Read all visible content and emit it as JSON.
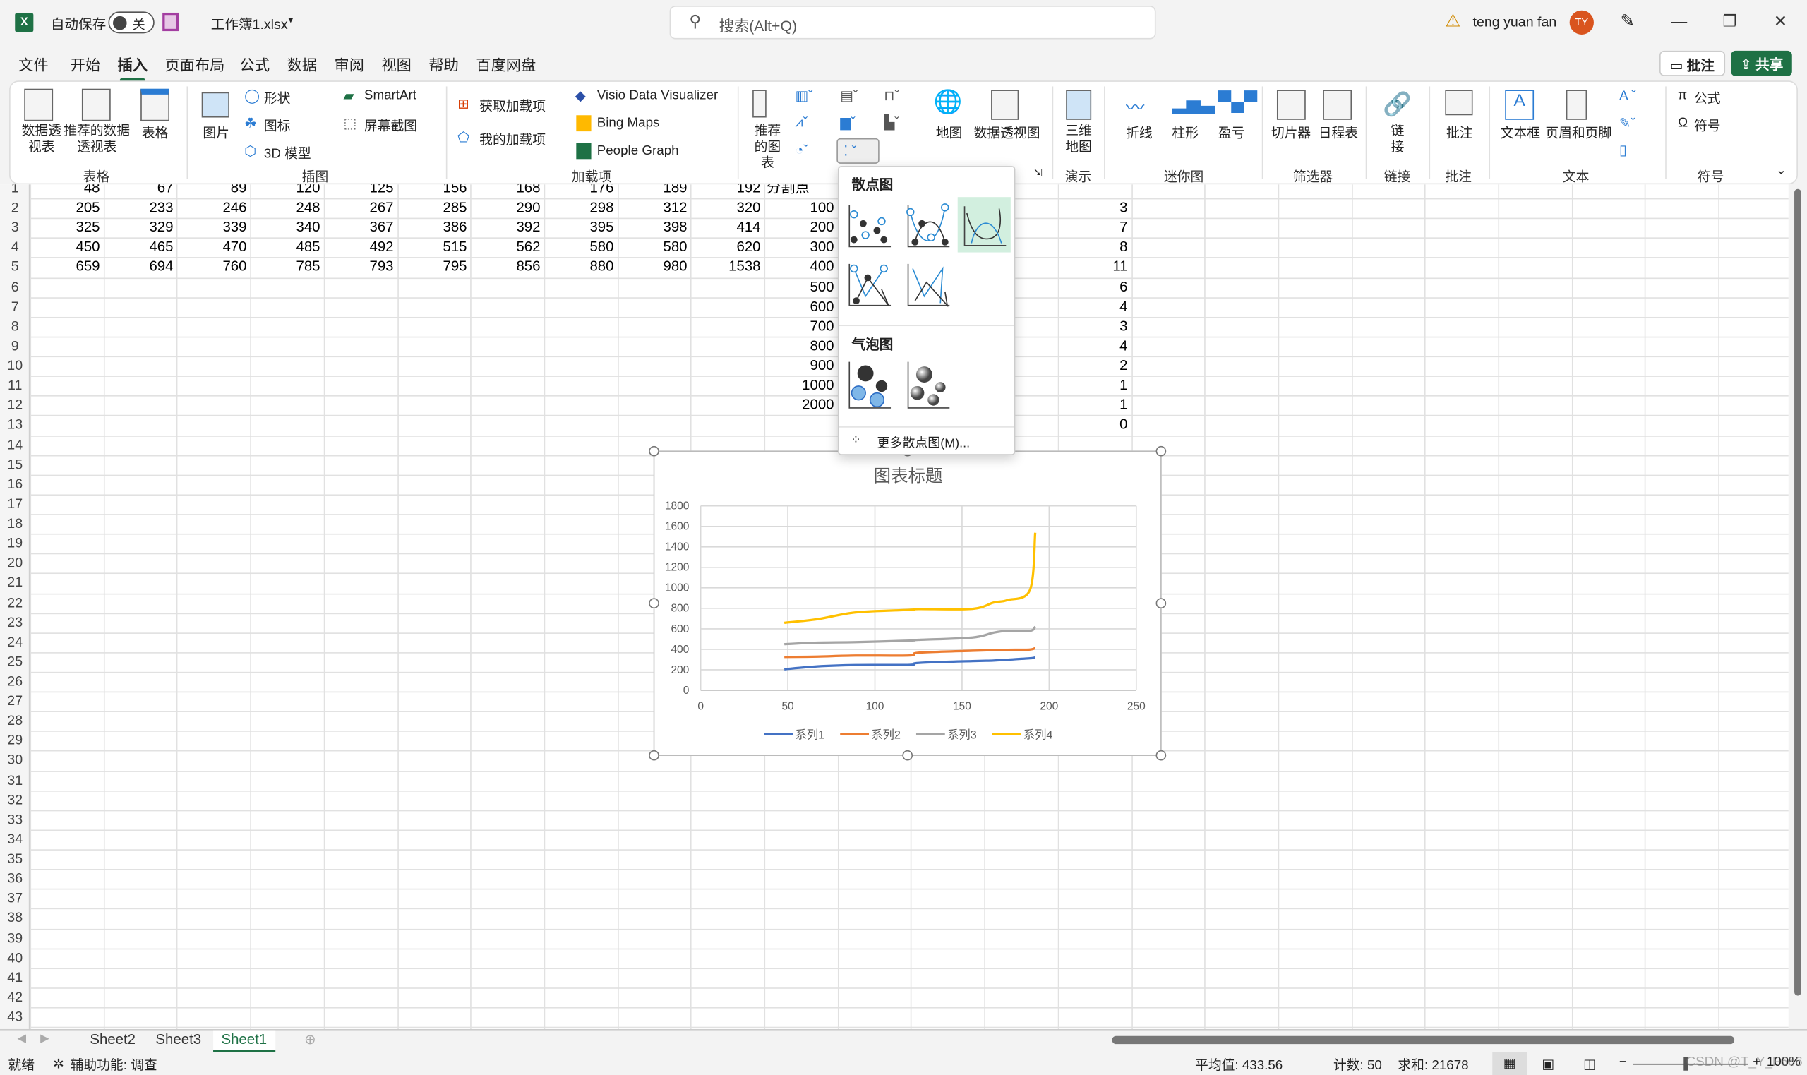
{
  "titlebar": {
    "autosave_label": "自动保存",
    "autosave_state": "关",
    "filename": "工作簿1.xlsx",
    "search_placeholder": "搜索(Alt+Q)",
    "user_name": "teng yuan fan",
    "avatar_initials": "TY",
    "accent": "#1e7145"
  },
  "menu": {
    "tabs": [
      "文件",
      "开始",
      "插入",
      "页面布局",
      "公式",
      "数据",
      "审阅",
      "视图",
      "帮助",
      "百度网盘"
    ],
    "active": "插入",
    "comments_label": "批注",
    "share_label": "共享"
  },
  "ribbon": {
    "tables": {
      "label": "表格",
      "pivot": "数据透视表",
      "recommended_pivot": "推荐的数据透视表",
      "table": "表格"
    },
    "illustrations": {
      "label": "插图",
      "picture": "图片",
      "shapes": "形状",
      "icons": "图标",
      "models3d": "3D 模型",
      "smartart": "SmartArt",
      "screenshot": "屏幕截图"
    },
    "addins": {
      "label": "加载项",
      "get": "获取加载项",
      "my": "我的加载项",
      "visio": "Visio Data Visualizer",
      "bing": "Bing Maps",
      "people": "People Graph"
    },
    "charts": {
      "recommended": "推荐的图表",
      "maps": "地图",
      "pivot_chart": "数据透视图"
    },
    "tours": {
      "label": "演示",
      "map3d": "三维地图"
    },
    "sparklines": {
      "label": "迷你图",
      "line": "折线",
      "column": "柱形",
      "winloss": "盈亏"
    },
    "filters": {
      "label": "筛选器",
      "slicer": "切片器",
      "timeline": "日程表"
    },
    "links": {
      "label": "链接",
      "link": "链接"
    },
    "comments": {
      "label": "批注",
      "comment": "批注"
    },
    "text": {
      "label": "文本",
      "textbox": "文本框",
      "header_footer": "页眉和页脚"
    },
    "symbols": {
      "label": "符号",
      "equation": "公式",
      "symbol": "符号"
    }
  },
  "grid": {
    "row_numbers": [
      1,
      2,
      3,
      4,
      5,
      6,
      7,
      8,
      9,
      10,
      11,
      12,
      13,
      14,
      15,
      16,
      17,
      18,
      19,
      20,
      21,
      22,
      23,
      24,
      25,
      26,
      27,
      28,
      29,
      30,
      31,
      32,
      33,
      34,
      35,
      36,
      37,
      38,
      39,
      40,
      41,
      42,
      43
    ],
    "rows": [
      [
        "48",
        "67",
        "89",
        "120",
        "125",
        "156",
        "168",
        "176",
        "189",
        "192"
      ],
      [
        "205",
        "233",
        "246",
        "248",
        "267",
        "285",
        "290",
        "298",
        "312",
        "320"
      ],
      [
        "325",
        "329",
        "339",
        "340",
        "367",
        "386",
        "392",
        "395",
        "398",
        "414"
      ],
      [
        "450",
        "465",
        "470",
        "485",
        "492",
        "515",
        "562",
        "580",
        "580",
        "620"
      ],
      [
        "659",
        "694",
        "760",
        "785",
        "793",
        "795",
        "856",
        "880",
        "980",
        "1538"
      ]
    ],
    "split_header": "分割点",
    "split_points": [
      "100",
      "200",
      "300",
      "400",
      "500",
      "600",
      "700",
      "800",
      "900",
      "1000",
      "2000"
    ],
    "counts": [
      "3",
      "7",
      "8",
      "11",
      "6",
      "4",
      "3",
      "4",
      "2",
      "1",
      "1",
      "0"
    ]
  },
  "chart_data": {
    "type": "scatter",
    "subtype": "smooth-lines",
    "title": "图表标题",
    "x": [
      48,
      67,
      89,
      120,
      125,
      156,
      168,
      176,
      189,
      192
    ],
    "series": [
      {
        "name": "系列1",
        "color": "#4472c4",
        "values": [
          205,
          233,
          246,
          248,
          267,
          285,
          290,
          298,
          312,
          320
        ]
      },
      {
        "name": "系列2",
        "color": "#ed7d31",
        "values": [
          325,
          329,
          339,
          340,
          367,
          386,
          392,
          395,
          398,
          414
        ]
      },
      {
        "name": "系列3",
        "color": "#a5a5a5",
        "values": [
          450,
          465,
          470,
          485,
          492,
          515,
          562,
          580,
          580,
          620
        ]
      },
      {
        "name": "系列4",
        "color": "#ffc000",
        "values": [
          659,
          694,
          760,
          785,
          793,
          795,
          856,
          880,
          980,
          1538
        ]
      }
    ],
    "xlim": [
      0,
      250
    ],
    "ylim": [
      0,
      1800
    ],
    "xticks": [
      "0",
      "50",
      "100",
      "150",
      "200",
      "250"
    ],
    "yticks": [
      "0",
      "200",
      "400",
      "600",
      "800",
      "1000",
      "1200",
      "1400",
      "1600",
      "1800"
    ],
    "grid": true,
    "legend": "bottom"
  },
  "dropdown": {
    "scatter_header": "散点图",
    "bubble_header": "气泡图",
    "more": "更多散点图(M)...",
    "scatter_items": [
      "scatter",
      "scatter-smooth-markers",
      "scatter-smooth-lines",
      "scatter-straight-markers",
      "scatter-straight-lines"
    ],
    "bubble_items": [
      "bubble",
      "bubble-3d"
    ],
    "selected": "scatter-smooth-lines"
  },
  "sheets": {
    "tabs": [
      "Sheet2",
      "Sheet3",
      "Sheet1"
    ],
    "active": "Sheet1"
  },
  "status": {
    "ready": "就绪",
    "accessibility": "辅助功能: 调查",
    "average": "平均值: 433.56",
    "count": "计数: 50",
    "sum": "求和: 21678",
    "zoom": "100%",
    "watermark": "CSDN @T_Y_F666"
  }
}
